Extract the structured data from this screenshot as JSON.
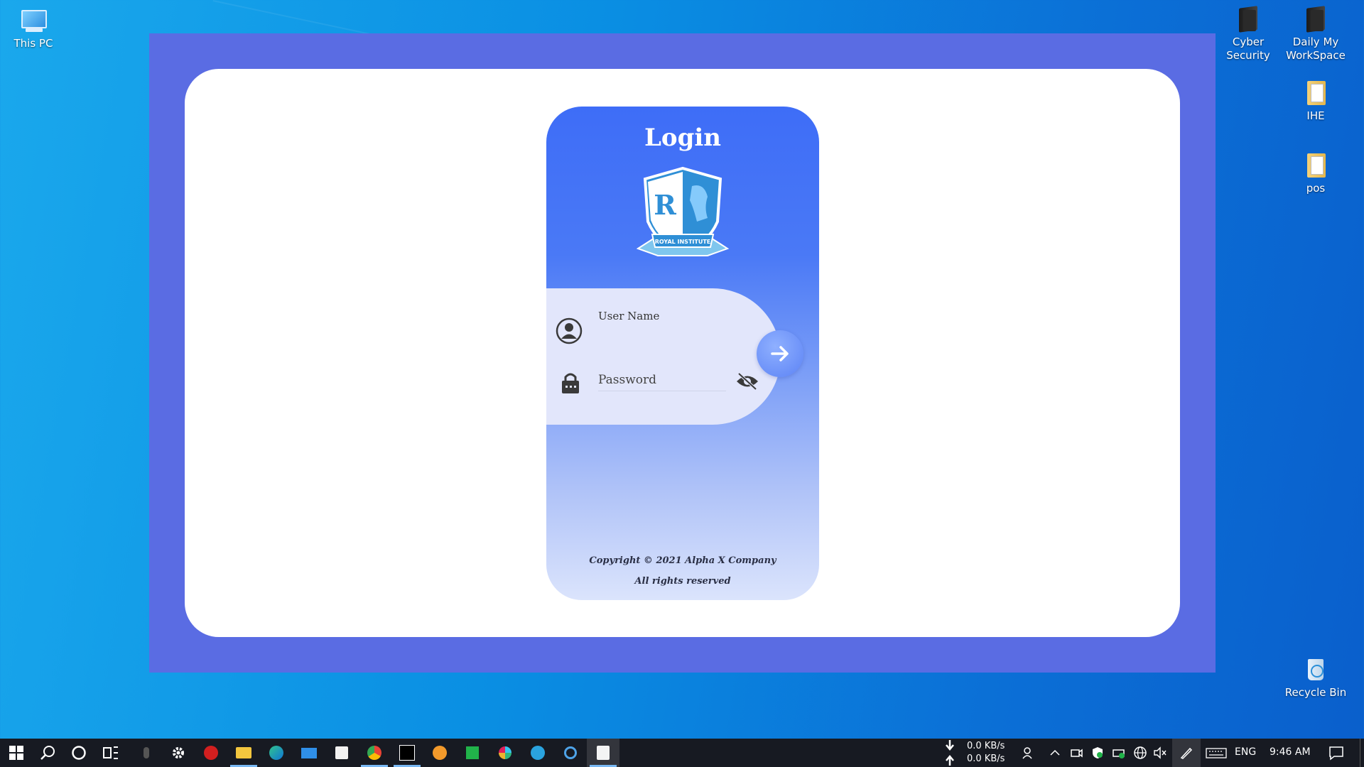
{
  "desktop": {
    "icons_left": [
      {
        "label": "This PC",
        "icon": "computer-icon"
      }
    ],
    "icons_right": [
      {
        "label_line1": "Cyber",
        "label_line2": "Security",
        "icon": "folder-icon"
      },
      {
        "label_line1": "Daily My",
        "label_line2": "WorkSpace",
        "icon": "folder-icon"
      },
      {
        "label_line1": "IHE",
        "label_line2": "",
        "icon": "folder-icon"
      },
      {
        "label_line1": "pos",
        "label_line2": "",
        "icon": "folder-icon"
      }
    ],
    "recycle_bin": {
      "label": "Recycle Bin",
      "icon": "recycle-bin-icon"
    }
  },
  "login": {
    "title": "Login",
    "logo_text": "ROYAL INSTITUTE",
    "logo_letter": "R",
    "username_label": "User Name",
    "password_placeholder": "Password",
    "copyright_line1": "Copyright © 2021 Alpha X Company",
    "copyright_line2": "All rights reserved"
  },
  "taskbar": {
    "network_down": "0.0 KB/s",
    "network_up": "0.0 KB/s",
    "language": "ENG",
    "time": "9:46 AM"
  },
  "colors": {
    "window_frame": "#5a6ce3",
    "panel_top": "#3e6df7",
    "panel_bottom": "#dbe4fc",
    "form_bg": "#e2e6fb",
    "taskbar": "#171a22"
  }
}
